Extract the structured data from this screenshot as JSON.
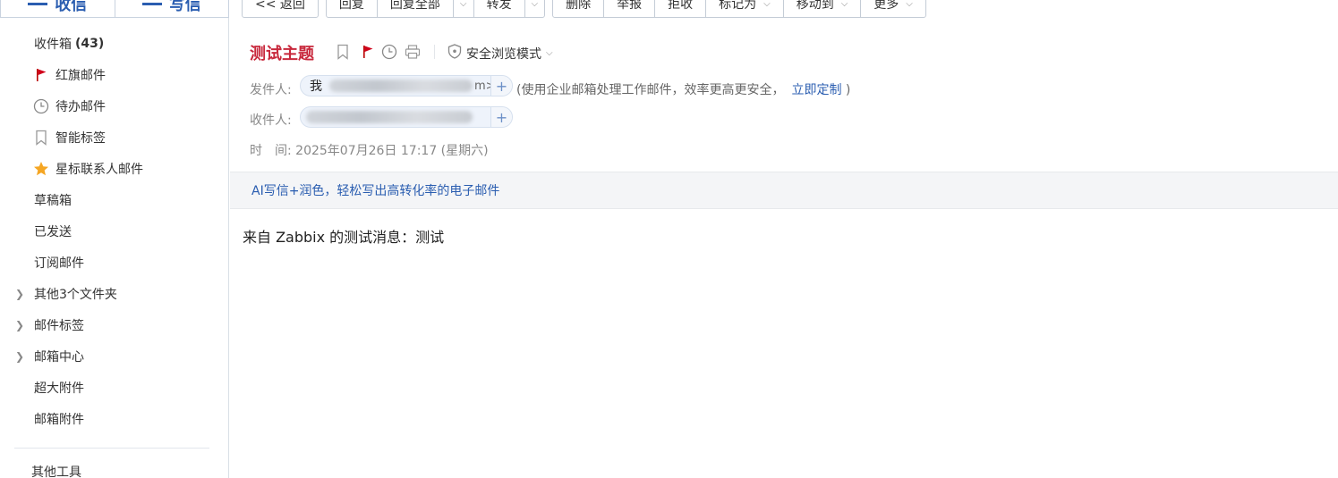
{
  "top_actions": {
    "inbox": "收信",
    "compose": "写信"
  },
  "sidebar": {
    "items": [
      {
        "label": "收件箱",
        "count": "(43)"
      },
      {
        "label": "红旗邮件",
        "icon": "red-flag-icon"
      },
      {
        "label": "待办邮件",
        "icon": "clock-icon"
      },
      {
        "label": "智能标签",
        "icon": "bookmark-icon"
      },
      {
        "label": "星标联系人邮件",
        "icon": "star-icon"
      },
      {
        "label": "草稿箱"
      },
      {
        "label": "已发送"
      },
      {
        "label": "订阅邮件"
      },
      {
        "label": "其他3个文件夹",
        "expandable": true
      },
      {
        "label": "邮件标签",
        "expandable": true
      },
      {
        "label": "邮箱中心",
        "expandable": true
      },
      {
        "label": "超大附件"
      },
      {
        "label": "邮箱附件"
      }
    ],
    "tools": "其他工具"
  },
  "toolbar": {
    "back": "<< 返回",
    "reply": "回复",
    "reply_all": "回复全部",
    "forward": "转发",
    "delete": "删除",
    "report": "举报",
    "reject": "拒收",
    "mark_as": "标记为",
    "move_to": "移动到",
    "more": "更多"
  },
  "mail": {
    "subject": "测试主题",
    "safe_mode": "安全浏览模式",
    "from_label": "发件人:",
    "from_name": "我",
    "from_tail": "m>",
    "sender_hint": "(使用企业邮箱处理工作邮件，效率更高更安全，",
    "sender_hint_link": "立即定制",
    "sender_hint_end": ")",
    "to_label": "收件人:",
    "time_label": "时　间:",
    "time_value": "2025年07月26日 17:17 (星期六)",
    "ai_banner": "AI写信+润色，轻松写出高转化率的电子邮件",
    "body": "来自 Zabbix 的测试消息：测试"
  },
  "colors": {
    "accent": "#2a5db0",
    "subject": "#c8283c",
    "flag": "#d0021b",
    "star": "#f5a623"
  }
}
